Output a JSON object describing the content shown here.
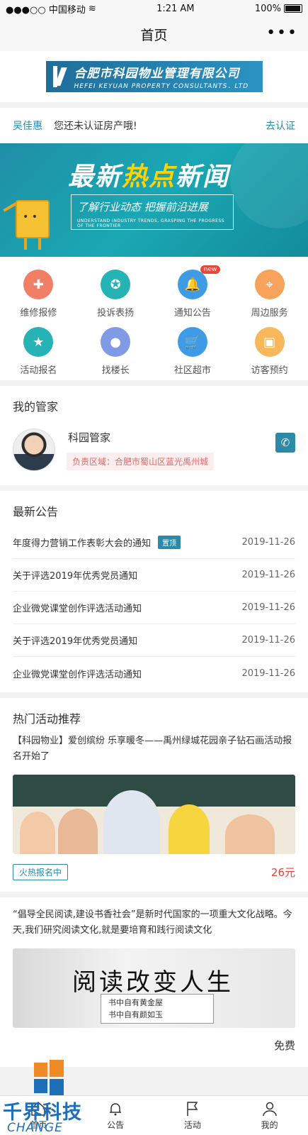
{
  "status": {
    "carrier": "●●●○○ 中国移动",
    "time": "1:21 AM",
    "battery": "100%"
  },
  "nav": {
    "title": "首页",
    "more": "•••"
  },
  "logo": {
    "cn": "合肥市科园物业管理有限公司",
    "en": "HEFEI KEYUAN PROPERTY CONSULTANTS．LTD"
  },
  "verify": {
    "name": "吴佳惠",
    "message": "您还未认证房产哦!",
    "link": "去认证"
  },
  "banner": {
    "title_a": "最新",
    "title_hl": "热点",
    "title_b": "新闻",
    "subtitle": "了解行业动态 把握前沿进展",
    "subtitle_en": "UNDERSTAND INDUSTRY TRENDS, GRASPING THE PROGRESS OF THE FRONTIER"
  },
  "services": [
    {
      "label": "维修报修",
      "icon": "repair-icon",
      "color": "#f07f65",
      "glyph": "✚"
    },
    {
      "label": "投诉表扬",
      "icon": "medal-icon",
      "color": "#26b3b5",
      "glyph": "✪"
    },
    {
      "label": "通知公告",
      "icon": "bell-icon",
      "color": "#3e9be6",
      "glyph": "🔔",
      "badge": "new"
    },
    {
      "label": "周边服务",
      "icon": "location-icon",
      "color": "#f7a35b",
      "glyph": "⌖"
    },
    {
      "label": "活动报名",
      "icon": "bookmark-icon",
      "color": "#26b3b5",
      "glyph": "★"
    },
    {
      "label": "找楼长",
      "icon": "person-icon",
      "color": "#7f9be6",
      "glyph": "●"
    },
    {
      "label": "社区超市",
      "icon": "cart-icon",
      "color": "#3e9be6",
      "glyph": "🛒"
    },
    {
      "label": "访客预约",
      "icon": "calendar-icon",
      "color": "#f7b85b",
      "glyph": "▣"
    }
  ],
  "butler": {
    "section_title": "我的管家",
    "name": "科园管家",
    "area": "负责区域：合肥市蜀山区蓝光禹州城"
  },
  "notices": {
    "section_title": "最新公告",
    "items": [
      {
        "title": "年度得力营销工作表彰大会的通知",
        "tag": "置顶",
        "date": "2019-11-26"
      },
      {
        "title": "关于评选2019年优秀党员通知",
        "date": "2019-11-26"
      },
      {
        "title": "企业微党课堂创作评选活动通知",
        "date": "2019-11-26"
      },
      {
        "title": "关于评选2019年优秀党员通知",
        "date": "2019-11-26"
      },
      {
        "title": "企业微党课堂创作评选活动通知",
        "date": "2019-11-26"
      }
    ]
  },
  "activities": {
    "section_title": "热门活动推荐",
    "first": {
      "desc": "【科园物业】爱创缤纷 乐享暖冬——禹州绿城花园亲子钻石画活动报名开始了",
      "tag": "火热报名中",
      "price": "26元"
    },
    "second": {
      "desc": "“倡导全民阅读,建设书香社会”是新时代国家的一项重大文化战略。今天,我们研究阅读文化,就是要培育和践行阅读文化",
      "image_title": "阅读改变人生",
      "image_line1": "书中自有黄金屋",
      "image_line2": "书中自有颜如玉",
      "price": "免费"
    }
  },
  "tabbar": [
    {
      "label": "首页",
      "icon": "home-icon"
    },
    {
      "label": "公告",
      "icon": "bell-icon"
    },
    {
      "label": "活动",
      "icon": "flag-icon"
    },
    {
      "label": "我的",
      "icon": "user-icon"
    }
  ],
  "watermark": {
    "text": "千界科技",
    "en": "CHANGE"
  }
}
